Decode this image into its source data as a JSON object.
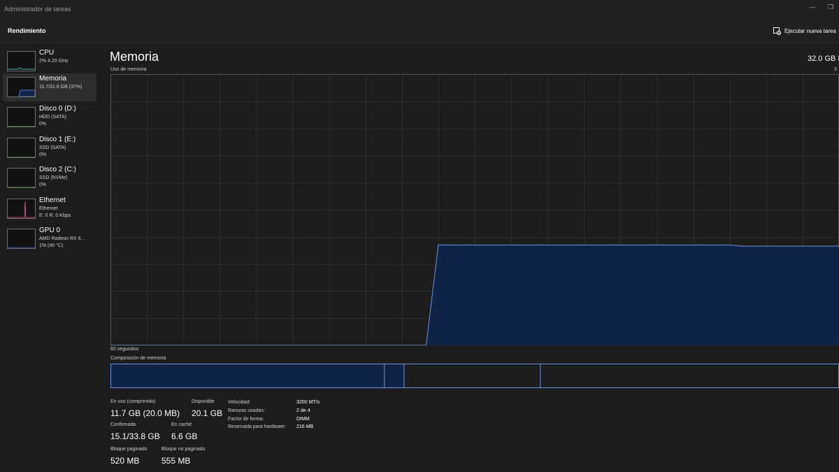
{
  "window": {
    "title": "Administrador de tareas"
  },
  "toolbar": {
    "page_title": "Rendimiento",
    "run_task_label": "Ejecutar nueva tarea"
  },
  "sidebar": {
    "items": [
      {
        "name": "CPU",
        "line1": "2% 4.20 GHz",
        "line2": "",
        "selected": false,
        "color": "#3fb0ac",
        "icon": "cpu-graph"
      },
      {
        "name": "Memoria",
        "line1": "11.7/31.8 GB (37%)",
        "line2": "",
        "selected": true,
        "color": "#4c7ad6",
        "icon": "memory-graph"
      },
      {
        "name": "Disco 0 (D:)",
        "line1": "HDD (SATA)",
        "line2": "0%",
        "selected": false,
        "color": "#6aa84f",
        "icon": "disk-graph"
      },
      {
        "name": "Disco 1 (E:)",
        "line1": "SSD (SATA)",
        "line2": "0%",
        "selected": false,
        "color": "#6aa84f",
        "icon": "disk-graph"
      },
      {
        "name": "Disco 2 (C:)",
        "line1": "SSD (NVMe)",
        "line2": "0%",
        "selected": false,
        "color": "#6aa84f",
        "icon": "disk-graph"
      },
      {
        "name": "Ethernet",
        "line1": "Ethernet",
        "line2": "E: 0 R: 0 Kbps",
        "selected": false,
        "color": "#c2557f",
        "icon": "network-graph"
      },
      {
        "name": "GPU 0",
        "line1": "AMD Radeon RX 6...",
        "line2": "1% (40 °C)",
        "selected": false,
        "color": "#4c7ad6",
        "icon": "gpu-graph"
      }
    ]
  },
  "main": {
    "title": "Memoria",
    "capacity": "32.0 GB D",
    "usage_label": "Uso de memoria",
    "usage_max": "3",
    "time_label": "60 segundos",
    "composition_label": "Composición de memoria",
    "usage_series": [
      0,
      0,
      0,
      0,
      0,
      0,
      0,
      0,
      0,
      0,
      0,
      0,
      0,
      0,
      0,
      0,
      0,
      0,
      0,
      0,
      0,
      0,
      0,
      0,
      0,
      0,
      0,
      37,
      37,
      37,
      37,
      37,
      37,
      37,
      37,
      37,
      37,
      37,
      37,
      37,
      37,
      37,
      37,
      37,
      37,
      37,
      37,
      37,
      37,
      37,
      37,
      37,
      36.6,
      36.6,
      36.6,
      36.6,
      36.6,
      36.6,
      36.6,
      36.6,
      36.6
    ],
    "composition": {
      "in_use_frac": 0.376,
      "modified_frac": 0.027,
      "standby_frac": 0.187
    },
    "stats": [
      {
        "label": "En uso (comprimido)",
        "value": "11.7 GB (20.0 MB)"
      },
      {
        "label": "Disponible",
        "value": "20.1 GB"
      },
      {
        "label": "Confirmada",
        "value": "15.1/33.8 GB"
      },
      {
        "label": "En caché",
        "value": "6.6 GB"
      },
      {
        "label": "Bloque paginado",
        "value": "520 MB"
      },
      {
        "label": "Bloque no paginado",
        "value": "555 MB"
      }
    ],
    "details": [
      {
        "label": "Velocidad:",
        "value": "3200 MT/s"
      },
      {
        "label": "Ranuras usadas:",
        "value": "2 de 4"
      },
      {
        "label": "Factor de forma:",
        "value": "DIMM"
      },
      {
        "label": "Reservada para hardware:",
        "value": "216 MB"
      }
    ]
  },
  "colors": {
    "accent": "#6d93e6",
    "fill": "#0f2346",
    "grid": "#2e2e2e"
  }
}
